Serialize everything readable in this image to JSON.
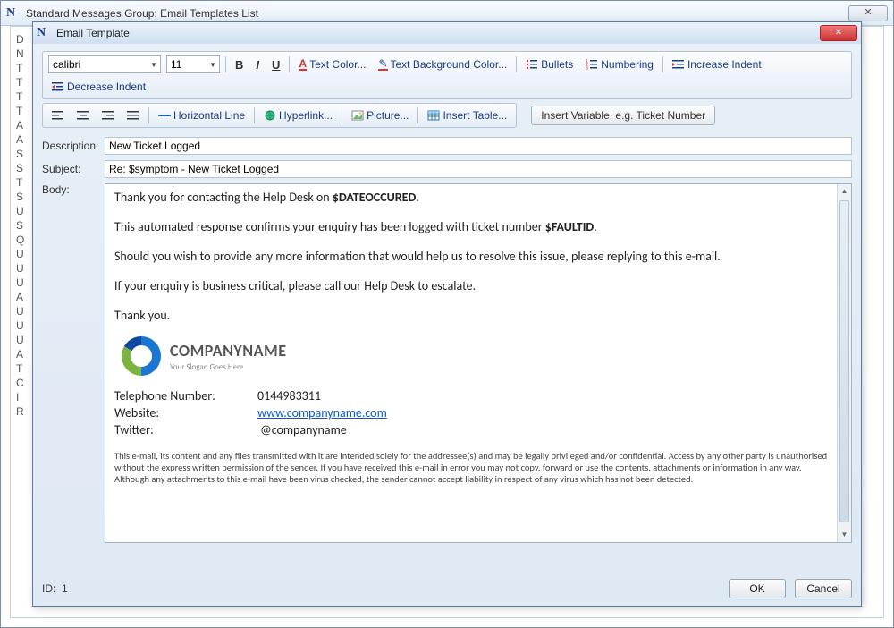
{
  "parentWindow": {
    "title": "Standard Messages Group: Email Templates List",
    "closeGlyph": "✕"
  },
  "bgListInitials": [
    "D",
    "N",
    "T",
    "T",
    "T",
    "T",
    "A",
    "A",
    "S",
    "S",
    "T",
    "S",
    "U",
    "S",
    "Q",
    "U",
    "U",
    "U",
    "A",
    "U",
    "U",
    "U",
    "A",
    "T",
    "C",
    "I",
    "R"
  ],
  "dialog": {
    "title": "Email Template",
    "closeGlyph": "✕",
    "idLabel": "ID:",
    "idValue": "1",
    "okLabel": "OK",
    "cancelLabel": "Cancel"
  },
  "toolbar": {
    "fontName": "calibri",
    "fontSize": "11",
    "bold": "B",
    "italic": "I",
    "underline": "U",
    "textColor": "Text Color...",
    "bgColor": "Text Background Color...",
    "bullets": "Bullets",
    "numbering": "Numbering",
    "incIndent": "Increase Indent",
    "decIndent": "Decrease Indent",
    "hr": "Horizontal Line",
    "hyperlink": "Hyperlink...",
    "picture": "Picture...",
    "insertTable": "Insert Table...",
    "insertVar": "Insert Variable, e.g. Ticket Number"
  },
  "form": {
    "descriptionLabel": "Description:",
    "descriptionValue": "New Ticket Logged",
    "subjectLabel": "Subject:",
    "subjectValue": "Re: $symptom - New Ticket Logged",
    "bodyLabel": "Body:"
  },
  "body": {
    "p1a": "Thank you for contacting the Help Desk on ",
    "p1b": "$DATEOCCURED",
    "p1c": ".",
    "p2a": "This automated response confirms your enquiry has been logged with ticket number ",
    "p2b": "$FAULTID",
    "p2c": ".",
    "p3": "Should you wish to provide any more information that would help us to resolve this issue, please replying to this e-mail.",
    "p4": "If your enquiry is business critical, please call our Help Desk to escalate.",
    "p5": "Thank you.",
    "companyName": "COMPANYNAME",
    "slogan": "Your Slogan Goes Here",
    "telLabel": "Telephone Number:",
    "telValue": "0144983311",
    "webLabel": "Website:",
    "webValue": "www.companyname.com",
    "twLabel": "Twitter:",
    "twValue": "@companyname",
    "disclaimer": "This e-mail, its content and any files transmitted with it are intended solely for the addressee(s) and may be legally privileged and/or confidential. Access by any other party is unauthorised without the express written permission of the sender. If you have received this e-mail in error you may not copy, forward or use the contents, attachments or information in any way. Although any attachments to this e-mail have been virus checked, the sender cannot accept liability in respect of any virus which has not been detected."
  }
}
